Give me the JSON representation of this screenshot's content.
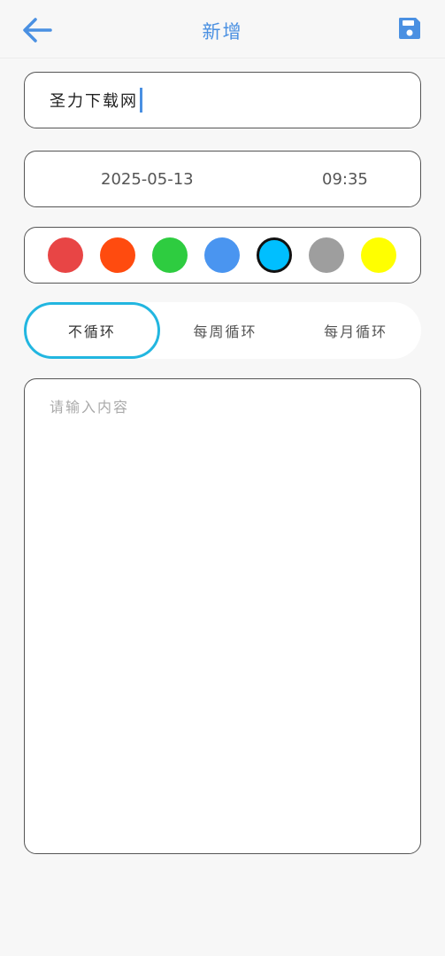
{
  "header": {
    "title": "新增",
    "back_icon": "arrow-left-icon",
    "save_icon": "floppy-save-icon",
    "accent_color": "#4a90e2"
  },
  "form": {
    "title_value": "圣力下载网",
    "date": "2025-05-13",
    "time": "09:35",
    "colors": [
      {
        "hex": "#e84545",
        "selected": false
      },
      {
        "hex": "#ff4b0f",
        "selected": false
      },
      {
        "hex": "#2ecc40",
        "selected": false
      },
      {
        "hex": "#4a95f0",
        "selected": false
      },
      {
        "hex": "#00bfff",
        "selected": true
      },
      {
        "hex": "#9e9e9e",
        "selected": false
      },
      {
        "hex": "#ffff00",
        "selected": false
      }
    ],
    "repeat_options": [
      {
        "label": "不循环",
        "active": true
      },
      {
        "label": "每周循环",
        "active": false
      },
      {
        "label": "每月循环",
        "active": false
      }
    ],
    "content_placeholder": "请输入内容",
    "content_value": ""
  }
}
